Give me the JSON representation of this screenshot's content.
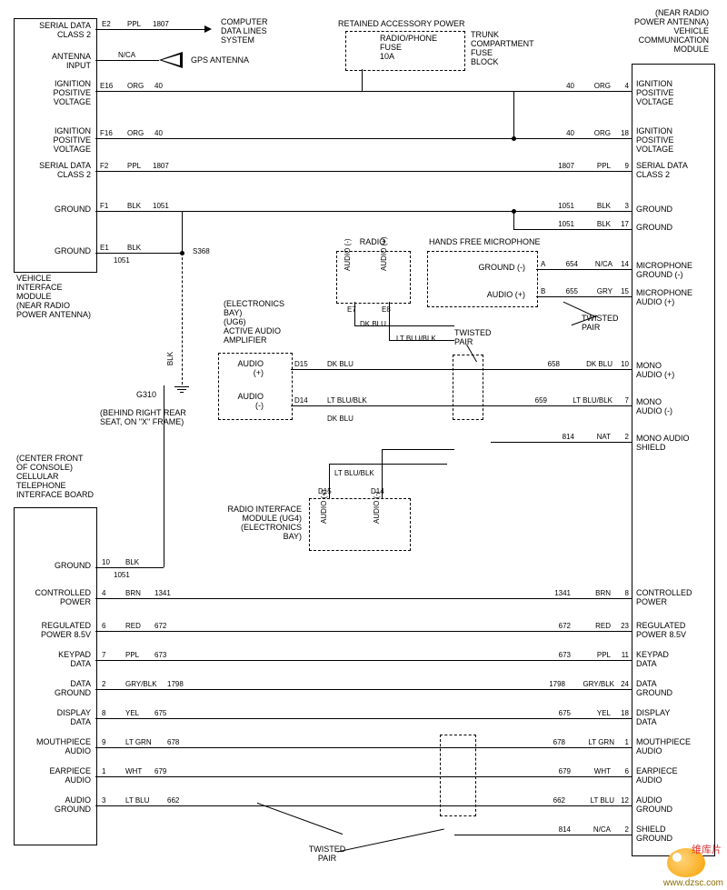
{
  "title_right": "(NEAR RADIO\nPOWER ANTENNA)\nVEHICLE\nCOMMUNICATION\nMODULE",
  "left_module_top": "VEHICLE\nINTERFACE\nMODULE\n(NEAR RADIO\nPOWER ANTENNA)",
  "left_module_bottom": "(CENTER FRONT\nOF CONSOLE)\nCELLULAR\nTELEPHONE\nINTERFACE BOARD",
  "retained": "RETAINED ACCESSORY POWER",
  "trunk": "TRUNK\nCOMPARTMENT\nFUSE\nBLOCK",
  "radio_phone": "RADIO/PHONE\nFUSE\n10A",
  "computer": "COMPUTER\nDATA LINES\nSYSTEM",
  "gps": "GPS ANTENNA",
  "radio": "RADIO",
  "hands_free": "HANDS FREE MICROPHONE",
  "ground_neg": "GROUND (-)",
  "audio_pos": "AUDIO (+)",
  "audio_neg": "AUDIO\n(-)",
  "audio_pos_v": "AUDIO\n(+)",
  "twisted": "TWISTED\nPAIR",
  "elec_bay": "(ELECTRONICS\nBAY)\n(UG6)\nACTIVE AUDIO\nAMPLIFIER",
  "radio_if": "RADIO INTERFACE\nMODULE (UG4)\n(ELECTRONICS\nBAY)",
  "g310": "G310",
  "behind": "(BEHIND RIGHT REAR\nSEAT, ON \"X\" FRAME)",
  "s368": "S368",
  "nca": "N/CA",
  "blk_v": "BLK",
  "left_rows": [
    {
      "name": "SERIAL DATA\nCLASS 2",
      "pin": "E2",
      "color": "PPL",
      "num": "1807"
    },
    {
      "name": "ANTENNA\nINPUT",
      "pin": "",
      "color": "",
      "num": ""
    },
    {
      "name": "IGNITION\nPOSITIVE\nVOLTAGE",
      "pin": "E16",
      "color": "ORG",
      "num": "40"
    },
    {
      "name": "IGNITION\nPOSITIVE\nVOLTAGE",
      "pin": "F16",
      "color": "ORG",
      "num": "40"
    },
    {
      "name": "SERIAL DATA\nCLASS 2",
      "pin": "F2",
      "color": "PPL",
      "num": "1807"
    },
    {
      "name": "GROUND",
      "pin": "F1",
      "color": "BLK",
      "num": "1051"
    },
    {
      "name": "GROUND",
      "pin": "E1",
      "color": "BLK",
      "num": ""
    }
  ],
  "right_rows_top": [
    {
      "name": "IGNITION\nPOSITIVE\nVOLTAGE",
      "pin": "4",
      "color": "ORG",
      "num": "40"
    },
    {
      "name": "IGNITION\nPOSITIVE\nVOLTAGE",
      "pin": "18",
      "color": "ORG",
      "num": "40"
    },
    {
      "name": "SERIAL DATA\nCLASS 2",
      "pin": "9",
      "color": "PPL",
      "num": "1807"
    },
    {
      "name": "GROUND",
      "pin": "3",
      "color": "BLK",
      "num": "1051"
    },
    {
      "name": "GROUND",
      "pin": "17",
      "color": "BLK",
      "num": "1051"
    },
    {
      "name": "MICROPHONE\nGROUND (-)",
      "pin": "14",
      "color": "N/CA",
      "num": "654"
    },
    {
      "name": "MICROPHONE\nAUDIO (+)",
      "pin": "15",
      "color": "GRY",
      "num": "655"
    },
    {
      "name": "MONO\nAUDIO (+)",
      "pin": "10",
      "color": "DK BLU",
      "num": "658"
    },
    {
      "name": "MONO\nAUDIO (-)",
      "pin": "7",
      "color": "LT BLU/BLK",
      "num": "659"
    },
    {
      "name": "MONO AUDIO\nSHIELD",
      "pin": "2",
      "color": "NAT",
      "num": "814"
    }
  ],
  "bottom_rows": [
    {
      "l": "GROUND",
      "lp": "10",
      "lc": "BLK",
      "ln": "1051",
      "rn": "",
      "rc": "",
      "rp": "",
      "r": ""
    },
    {
      "l": "CONTROLLED\nPOWER",
      "lp": "4",
      "lc": "BRN",
      "ln": "1341",
      "rn": "1341",
      "rc": "BRN",
      "rp": "8",
      "r": "CONTROLLED\nPOWER"
    },
    {
      "l": "REGULATED\nPOWER 8.5V",
      "lp": "6",
      "lc": "RED",
      "ln": "672",
      "rn": "672",
      "rc": "RED",
      "rp": "23",
      "r": "REGULATED\nPOWER 8.5V"
    },
    {
      "l": "KEYPAD\nDATA",
      "lp": "7",
      "lc": "PPL",
      "ln": "673",
      "rn": "673",
      "rc": "PPL",
      "rp": "11",
      "r": "KEYPAD\nDATA"
    },
    {
      "l": "DATA\nGROUND",
      "lp": "2",
      "lc": "GRY/BLK",
      "ln": "1798",
      "rn": "1798",
      "rc": "GRY/BLK",
      "rp": "24",
      "r": "DATA\nGROUND"
    },
    {
      "l": "DISPLAY\nDATA",
      "lp": "8",
      "lc": "YEL",
      "ln": "675",
      "rn": "675",
      "rc": "YEL",
      "rp": "18",
      "r": "DISPLAY\nDATA"
    },
    {
      "l": "MOUTHPIECE\nAUDIO",
      "lp": "9",
      "lc": "LT GRN",
      "ln": "678",
      "rn": "678",
      "rc": "LT GRN",
      "rp": "1",
      "r": "MOUTHPIECE\nAUDIO"
    },
    {
      "l": "EARPIECE\nAUDIO",
      "lp": "1",
      "lc": "WHT",
      "ln": "679",
      "rn": "679",
      "rc": "WHT",
      "rp": "6",
      "r": "EARPIECE\nAUDIO"
    },
    {
      "l": "AUDIO\nGROUND",
      "lp": "3",
      "lc": "LT BLU",
      "ln": "662",
      "rn": "662",
      "rc": "LT BLU",
      "rp": "12",
      "r": "AUDIO\nGROUND"
    },
    {
      "l": "",
      "lp": "",
      "lc": "",
      "ln": "",
      "rn": "814",
      "rc": "N/CA",
      "rp": "2",
      "r": "SHIELD\nGROUND"
    }
  ],
  "wire_colors": {
    "dkblu": "DK BLU",
    "ltblublk": "LT BLU/BLK"
  },
  "pins": {
    "e7": "E7",
    "e8": "E8",
    "d15": "D15",
    "d14": "D14",
    "a": "A",
    "b": "B"
  },
  "watermark": "www.dzsc.com",
  "badge": "维库片"
}
